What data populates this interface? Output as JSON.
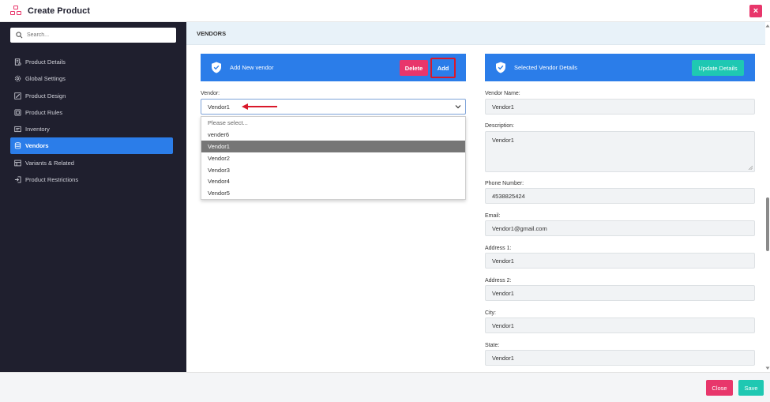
{
  "header": {
    "title": "Create Product",
    "close_icon": "×"
  },
  "sidebar": {
    "search_placeholder": "Search...",
    "items": [
      {
        "label": "Product Details",
        "icon": "document-icon"
      },
      {
        "label": "Global Settings",
        "icon": "gear-icon"
      },
      {
        "label": "Product Design",
        "icon": "pencil-icon"
      },
      {
        "label": "Product Rules",
        "icon": "rules-icon"
      },
      {
        "label": "Inventory",
        "icon": "inventory-icon"
      },
      {
        "label": "Vendors",
        "icon": "database-icon",
        "active": true
      },
      {
        "label": "Variants & Related",
        "icon": "variants-icon"
      },
      {
        "label": "Product Restrictions",
        "icon": "restriction-icon"
      }
    ]
  },
  "main": {
    "section_title": "VENDORS",
    "left_panel": {
      "title": "Add New vendor",
      "delete_label": "Delete",
      "add_label": "Add",
      "vendor_label": "Vendor:",
      "selected_value": "Vendor1",
      "options": [
        "Please select...",
        "vender6",
        "Vendor1",
        "Vendor2",
        "Vendor3",
        "Vendor4",
        "Vendor5"
      ],
      "selected_index": 2
    },
    "right_panel": {
      "title": "Selected Vendor Details",
      "update_label": "Update Details",
      "fields": {
        "vendor_name": {
          "label": "Vendor Name:",
          "value": "Vendor1"
        },
        "description": {
          "label": "Description:",
          "value": "Vendor1"
        },
        "phone": {
          "label": "Phone Number:",
          "value": "4538825424"
        },
        "email": {
          "label": "Email:",
          "value": "Vendor1@gmail.com"
        },
        "address1": {
          "label": "Address 1:",
          "value": "Vendor1"
        },
        "address2": {
          "label": "Address 2:",
          "value": "Vendor1"
        },
        "city": {
          "label": "City:",
          "value": "Vendor1"
        },
        "state": {
          "label": "State:",
          "value": "Vendor1"
        }
      }
    }
  },
  "footer": {
    "close_label": "Close",
    "save_label": "Save"
  },
  "colors": {
    "accent": "#2b7de9",
    "danger": "#e8366b",
    "success": "#1fc8b2",
    "sidebar": "#1f1f2e",
    "highlight": "#d9182a"
  }
}
